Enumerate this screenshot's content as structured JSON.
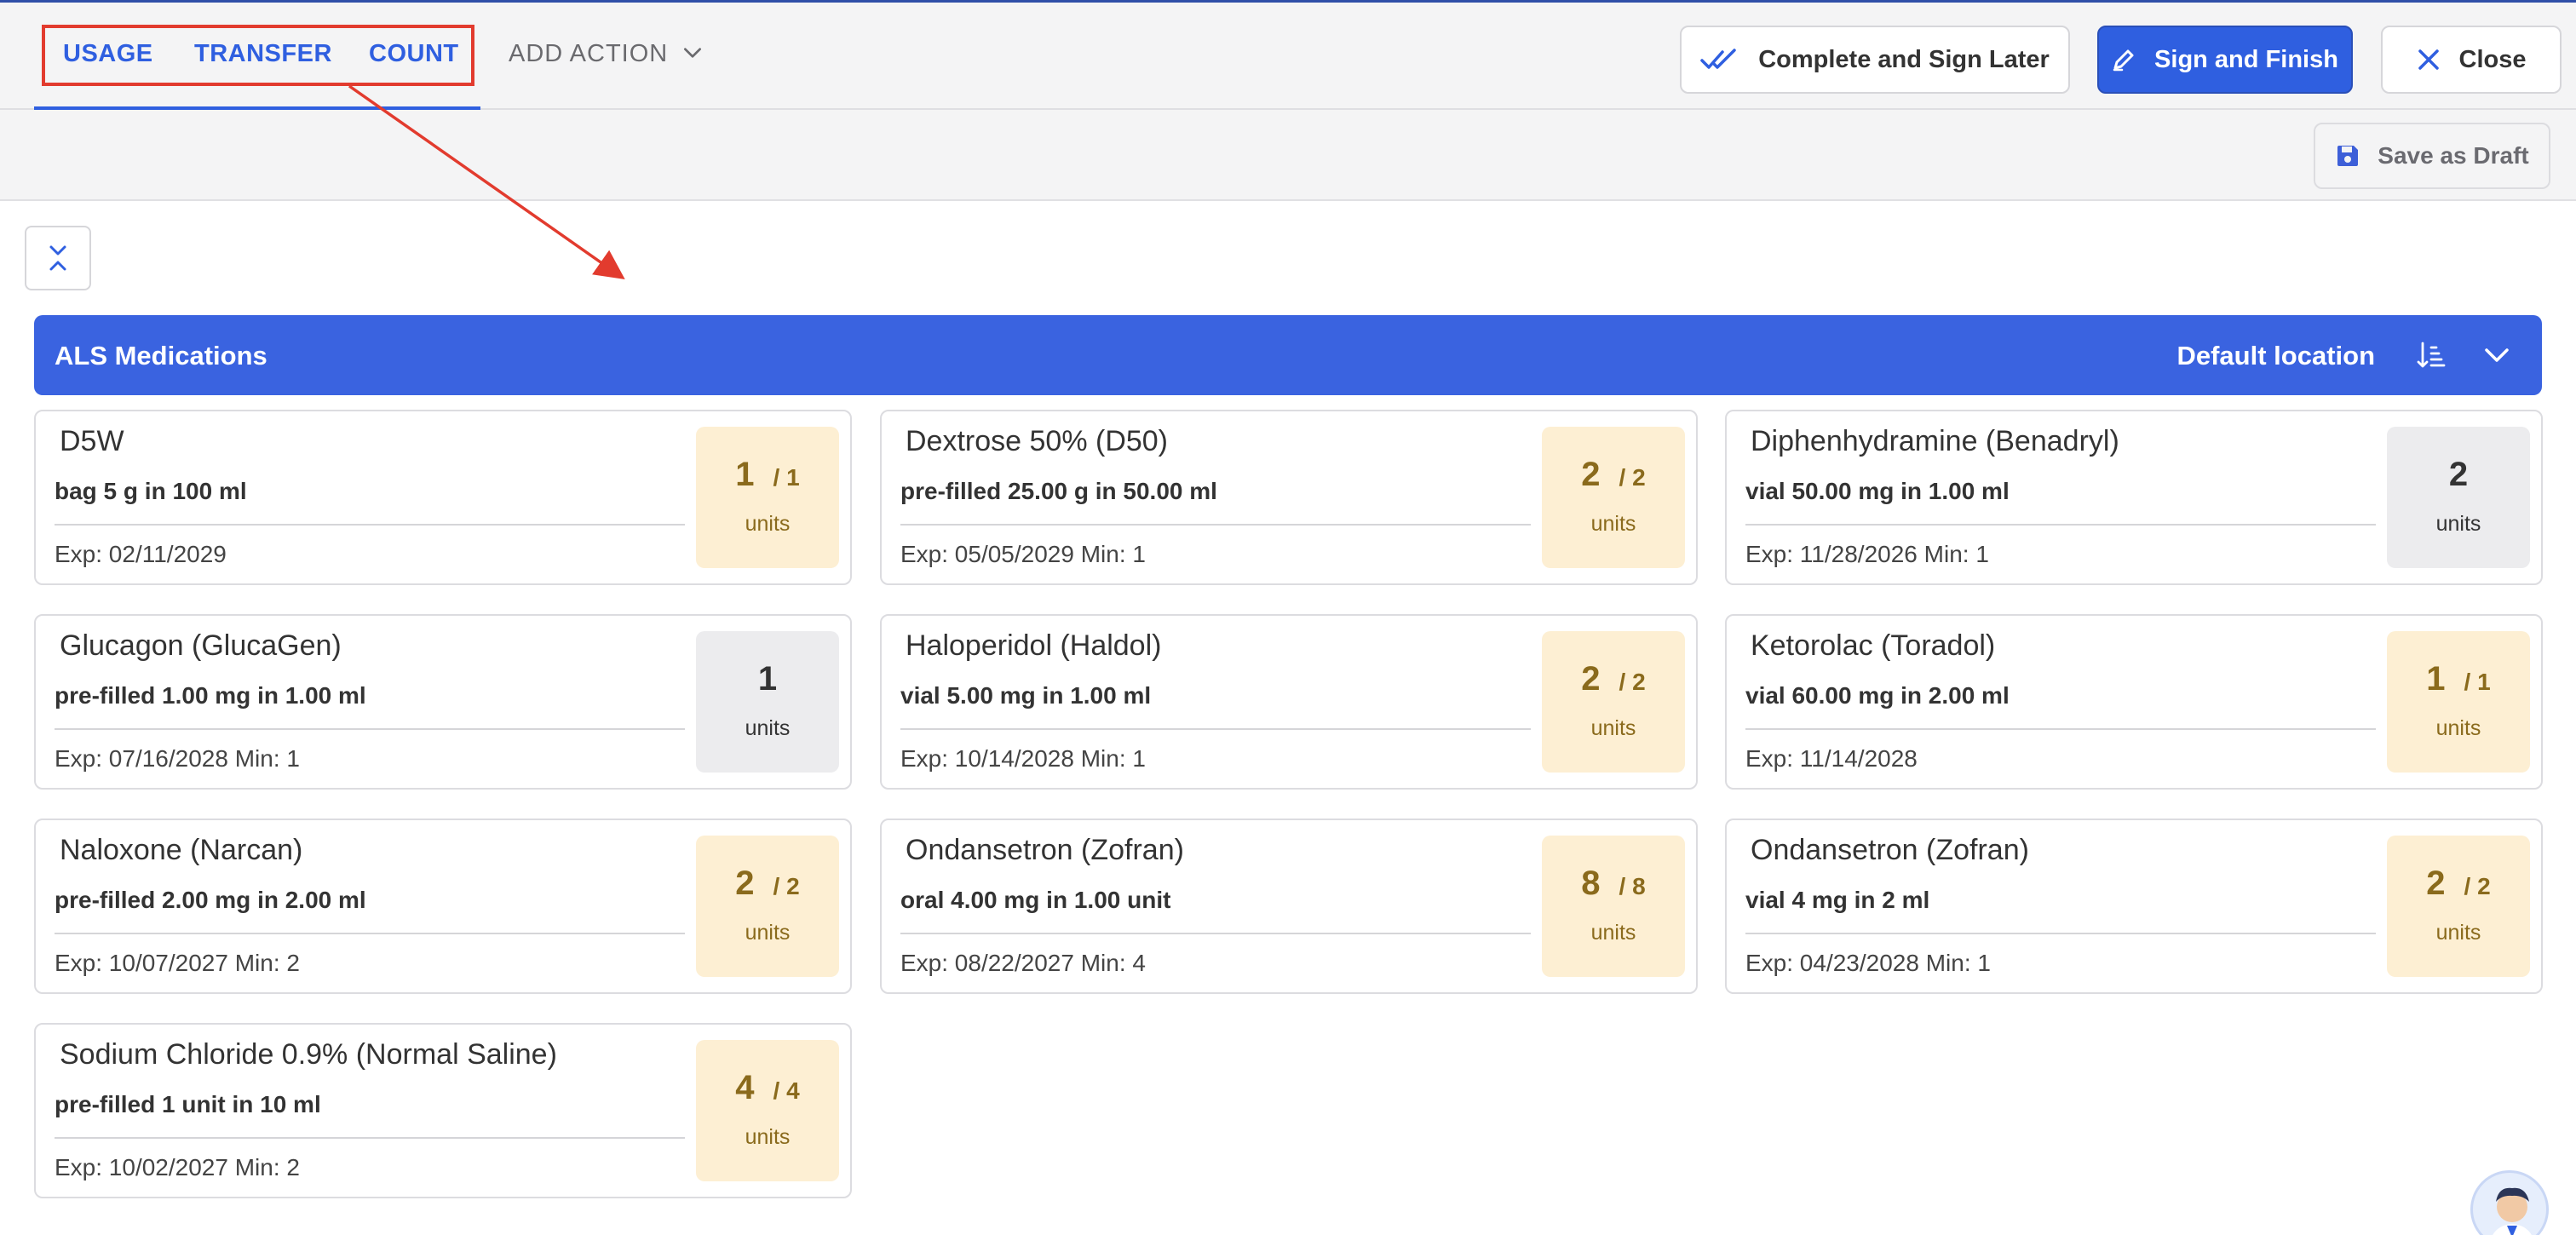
{
  "tabs": [
    {
      "label": "USAGE"
    },
    {
      "label": "TRANSFER"
    },
    {
      "label": "COUNT"
    }
  ],
  "add_action_label": "ADD ACTION",
  "buttons": {
    "complete_later": "Complete and Sign Later",
    "sign_finish": "Sign and Finish",
    "close": "Close",
    "save_draft": "Save as Draft"
  },
  "section": {
    "title": "ALS Medications",
    "location": "Default location"
  },
  "cards": [
    {
      "name": "D5W",
      "desc": "bag 5 g in 100 ml",
      "exp": "Exp: 02/11/2029",
      "qty": "1",
      "total": "/ 1",
      "unit": "units",
      "style": "warn"
    },
    {
      "name": "Dextrose 50% (D50)",
      "desc": "pre-filled 25.00 g in 50.00 ml",
      "exp": "Exp: 05/05/2029  Min: 1",
      "qty": "2",
      "total": "/ 2",
      "unit": "units",
      "style": "warn"
    },
    {
      "name": "Diphenhydramine (Benadryl)",
      "desc": "vial 50.00 mg in 1.00 ml",
      "exp": "Exp: 11/28/2026 Min: 1",
      "qty": "2",
      "total": "",
      "unit": "units",
      "style": "neutral"
    },
    {
      "name": "Glucagon (GlucaGen)",
      "desc": "pre-filled 1.00 mg in 1.00 ml",
      "exp": "Exp: 07/16/2028 Min: 1",
      "qty": "1",
      "total": "",
      "unit": "units",
      "style": "neutral"
    },
    {
      "name": "Haloperidol (Haldol)",
      "desc": "vial 5.00 mg in 1.00 ml",
      "exp": "Exp: 10/14/2028  Min: 1",
      "qty": "2",
      "total": "/ 2",
      "unit": "units",
      "style": "warn"
    },
    {
      "name": "Ketorolac (Toradol)",
      "desc": "vial 60.00 mg in 2.00 ml",
      "exp": "Exp: 11/14/2028",
      "qty": "1",
      "total": "/ 1",
      "unit": "units",
      "style": "warn"
    },
    {
      "name": "Naloxone (Narcan)",
      "desc": "pre-filled 2.00 mg in 2.00 ml",
      "exp": "Exp: 10/07/2027 Min: 2",
      "qty": "2",
      "total": "/ 2",
      "unit": "units",
      "style": "warn"
    },
    {
      "name": "Ondansetron (Zofran)",
      "desc": "oral 4.00 mg in 1.00 unit",
      "exp": "Exp: 08/22/2027  Min: 4",
      "qty": "8",
      "total": "/ 8",
      "unit": "units",
      "style": "warn"
    },
    {
      "name": "Ondansetron (Zofran)",
      "desc": "vial 4 mg in 2 ml",
      "exp": "Exp: 04/23/2028  Min: 1",
      "qty": "2",
      "total": "/ 2",
      "unit": "units",
      "style": "warn"
    },
    {
      "name": "Sodium Chloride 0.9% (Normal Saline)",
      "desc": "pre-filled 1 unit in 10 ml",
      "exp": "Exp: 10/02/2027  Min: 2",
      "qty": "4",
      "total": "/ 4",
      "unit": "units",
      "style": "warn"
    }
  ],
  "colors": {
    "primary": "#2f5fe0",
    "section_bar": "#3a63e0",
    "annotation": "#e23b2e",
    "warn_badge_bg": "#fdefd3",
    "warn_badge_text": "#8a6a1c",
    "neutral_badge_bg": "#ececee"
  },
  "icons": {
    "complete_later": "double-check-icon",
    "sign_finish": "pen-icon",
    "close": "close-icon",
    "save_draft": "floppy-disk-icon",
    "collapse": "collapse-chevrons-icon",
    "sort": "sort-descending-icon",
    "section_toggle": "chevron-down-icon",
    "add_action": "chevron-down-icon"
  }
}
